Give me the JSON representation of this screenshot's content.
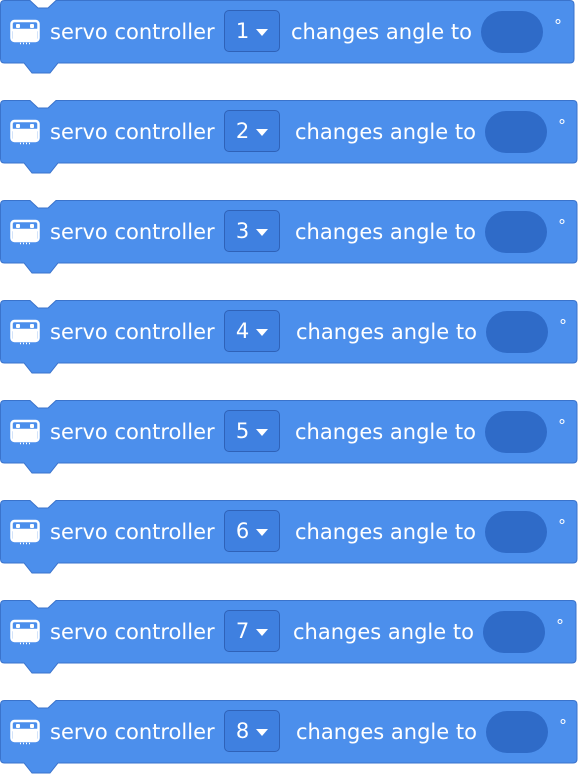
{
  "colors": {
    "block_fill": "#4c8fec",
    "block_stroke": "#3a73cc",
    "dropdown_fill": "#3f80e0",
    "angle_fill": "#2f6bc8",
    "text": "#ffffff"
  },
  "icon": "robot-board-icon",
  "blocks": [
    {
      "label": "servo controller",
      "dropdown": "1",
      "action": "changes angle to",
      "angle": "",
      "unit": "°"
    },
    {
      "label": "servo controller",
      "dropdown": "2",
      "action": "changes angle to",
      "angle": "",
      "unit": "°"
    },
    {
      "label": "servo controller",
      "dropdown": "3",
      "action": "changes angle to",
      "angle": "",
      "unit": "°"
    },
    {
      "label": "servo controller",
      "dropdown": "4",
      "action": "changes angle to",
      "angle": "",
      "unit": "°"
    },
    {
      "label": "servo controller",
      "dropdown": "5",
      "action": "changes angle to",
      "angle": "",
      "unit": "°"
    },
    {
      "label": "servo controller",
      "dropdown": "6",
      "action": "changes angle to",
      "angle": "",
      "unit": "°"
    },
    {
      "label": "servo controller",
      "dropdown": "7",
      "action": "changes angle to",
      "angle": "",
      "unit": "°"
    },
    {
      "label": "servo controller",
      "dropdown": "8",
      "action": "changes angle to",
      "angle": "",
      "unit": "°"
    }
  ]
}
